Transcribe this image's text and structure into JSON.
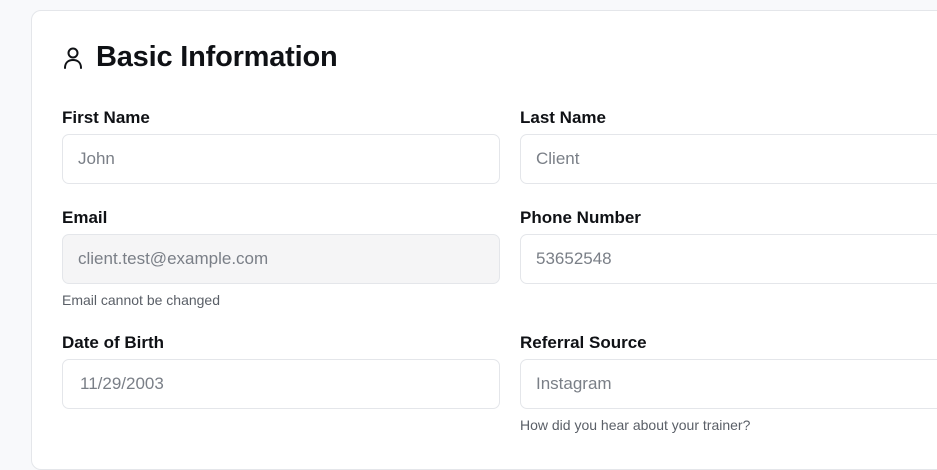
{
  "section": {
    "title": "Basic Information",
    "icon": "user-icon"
  },
  "fields": {
    "first_name": {
      "label": "First Name",
      "value": "John"
    },
    "last_name": {
      "label": "Last Name",
      "value": "Client"
    },
    "email": {
      "label": "Email",
      "value": "client.test@example.com",
      "helper": "Email cannot be changed"
    },
    "phone": {
      "label": "Phone Number",
      "value": "53652548"
    },
    "dob": {
      "label": "Date of Birth",
      "value": "11/29/2003"
    },
    "referral": {
      "label": "Referral Source",
      "value": "Instagram",
      "helper": "How did you hear about your trainer?"
    }
  }
}
